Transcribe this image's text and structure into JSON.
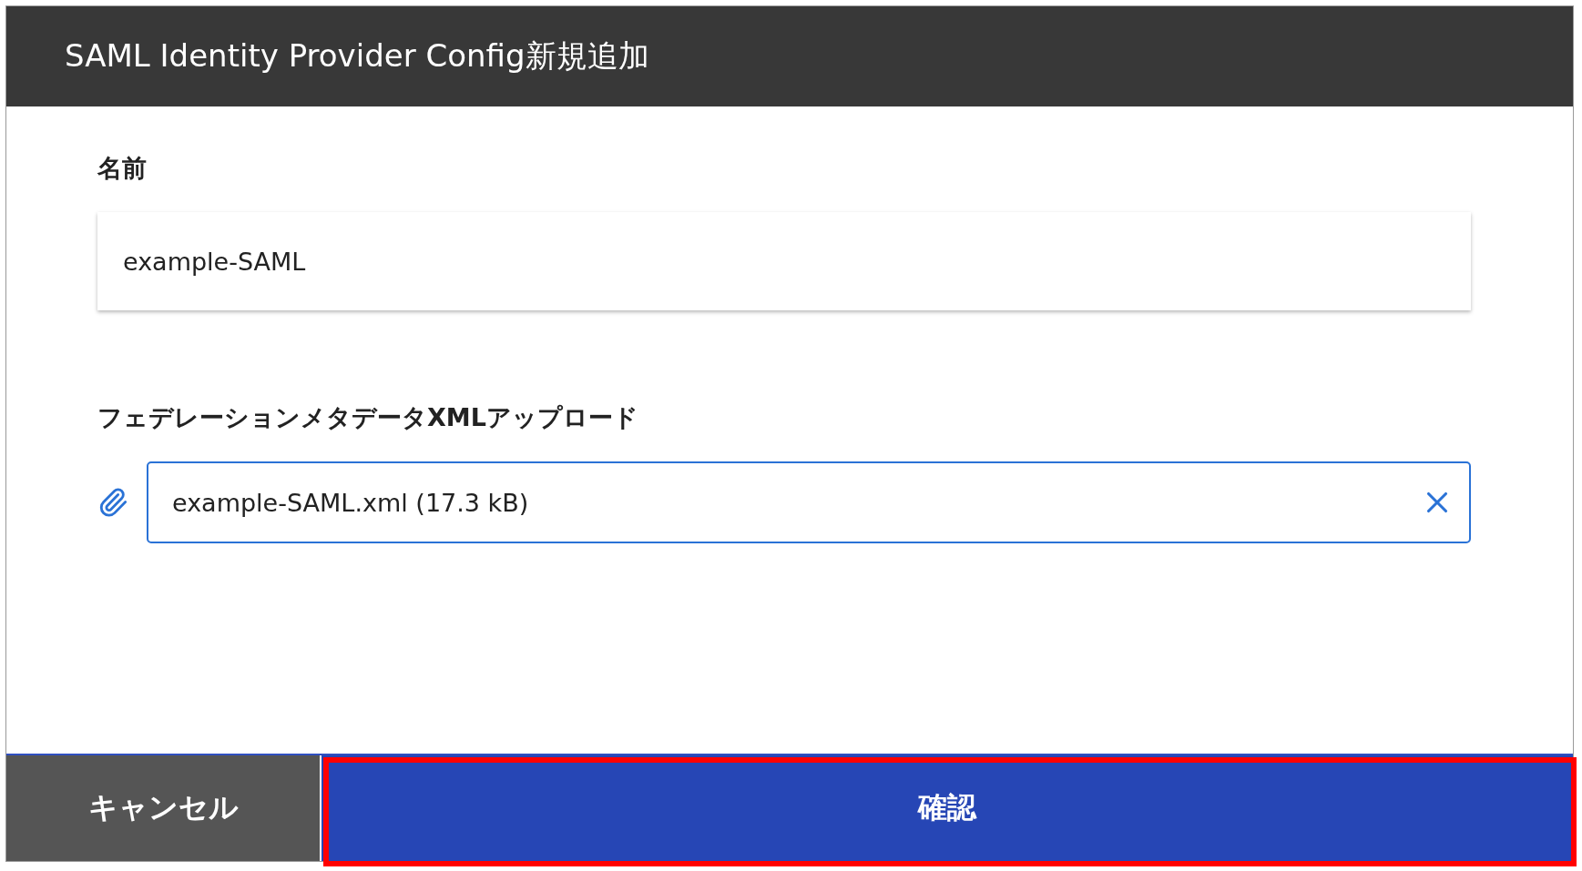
{
  "dialog": {
    "title": "SAML Identity Provider Config新規追加"
  },
  "fields": [
    {
      "kind": "text",
      "label": "名前",
      "value": "example-SAML"
    },
    {
      "kind": "file",
      "label": "フェデレーションメタデータXMLアップロード",
      "value": "example-SAML.xml (17.3 kB)"
    }
  ],
  "buttons": [
    {
      "kind": "cancel",
      "label": "キャンセル",
      "highlighted": false
    },
    {
      "kind": "primary",
      "label": "確認",
      "highlighted": true
    }
  ]
}
